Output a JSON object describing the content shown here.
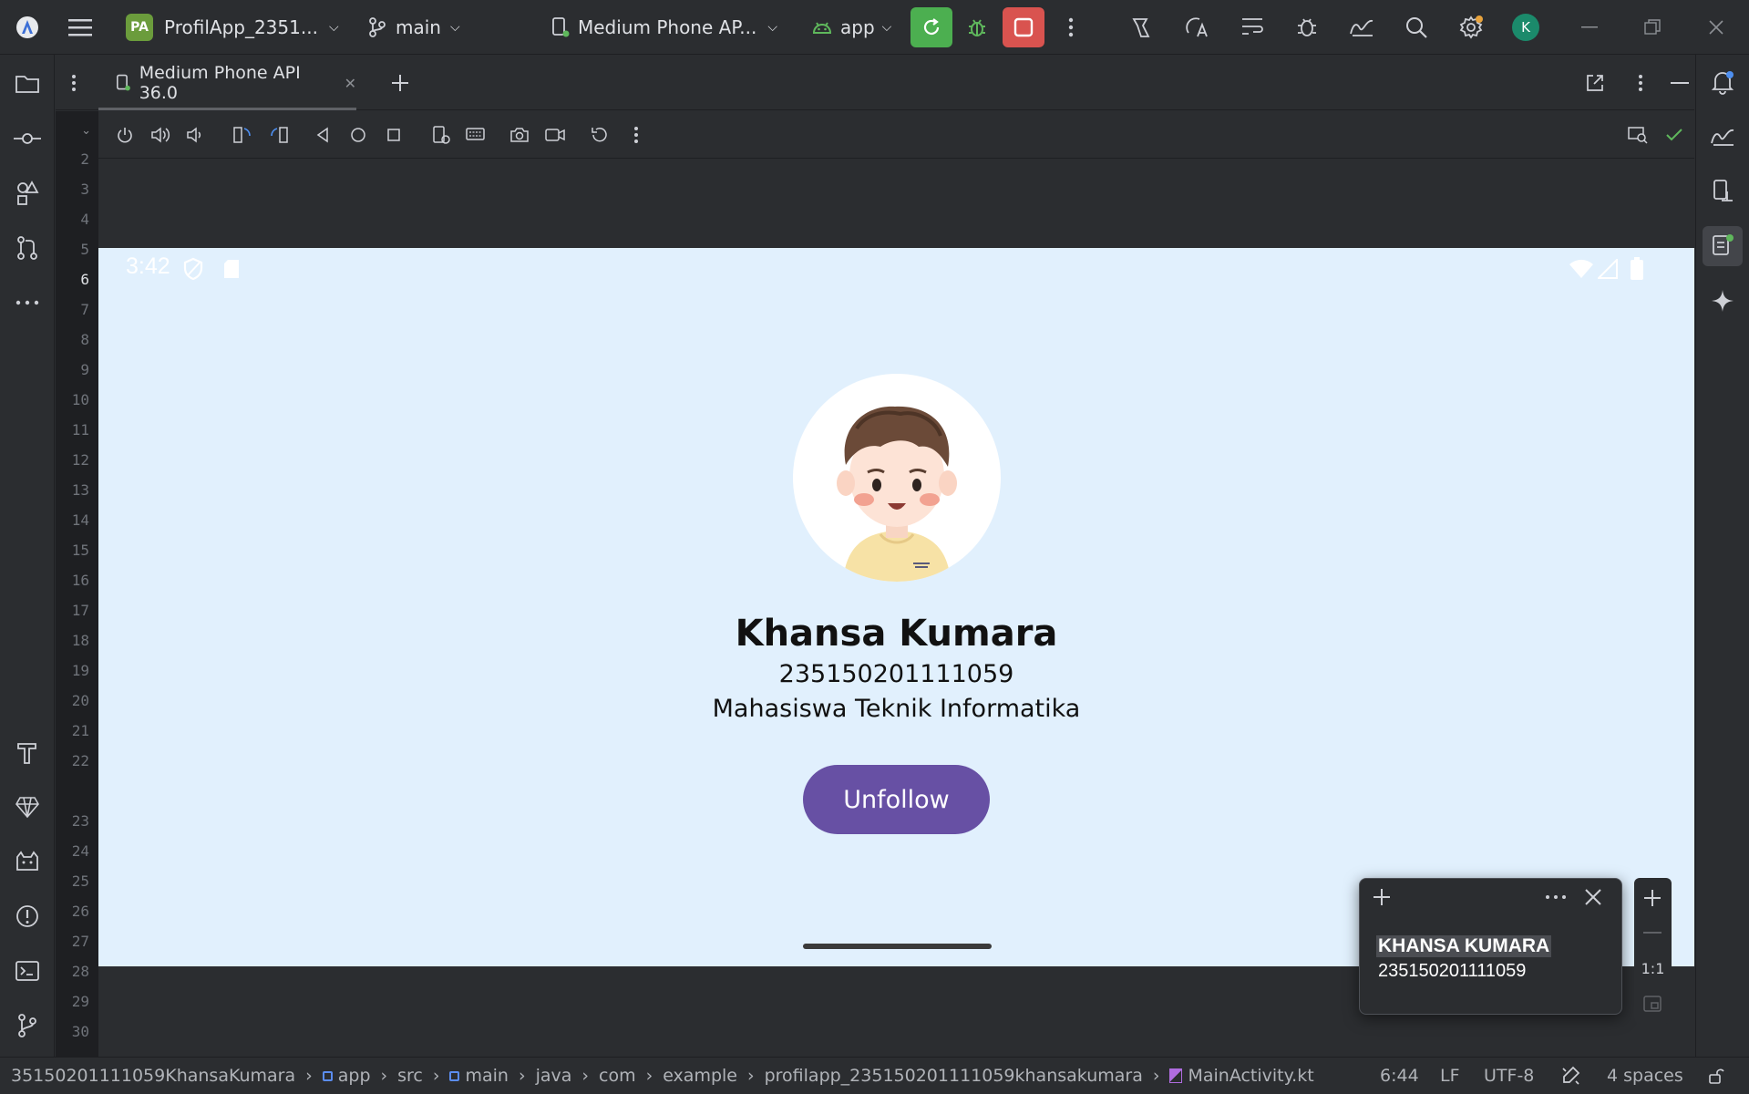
{
  "titlebar": {
    "project_badge": "PA",
    "project_name": "ProfilApp_2351...",
    "branch": "main",
    "device": "Medium Phone AP...",
    "run_config": "app",
    "user_initial": "K"
  },
  "tab": {
    "label": "Medium Phone API 36.0"
  },
  "line_numbers": [
    "2",
    "3",
    "4",
    "5",
    "6",
    "7",
    "8",
    "9",
    "10",
    "11",
    "12",
    "13",
    "14",
    "15",
    "16",
    "17",
    "18",
    "19",
    "20",
    "21",
    "22",
    "23",
    "24",
    "25",
    "26",
    "27",
    "28",
    "29",
    "30"
  ],
  "phone": {
    "clock": "3:42",
    "name": "Khansa Kumara",
    "nim": "235150201111059",
    "role": "Mahasiswa Teknik Informatika",
    "button_label": "Unfollow"
  },
  "popup": {
    "title": "KHANSA KUMARA",
    "subtitle": "235150201111059"
  },
  "zoom": {
    "ratio": "1:1"
  },
  "statusbar": {
    "breadcrumbs": [
      "35150201111059KhansaKumara",
      "app",
      "src",
      "main",
      "java",
      "com",
      "example",
      "profilapp_235150201111059khansakumara",
      "MainActivity.kt"
    ],
    "position": "6:44",
    "line_ending": "LF",
    "encoding": "UTF-8",
    "indent": "4 spaces"
  },
  "colors": {
    "ide_bg": "#2b2d30",
    "phone_bg": "#e1f0fd",
    "button": "#6750a4",
    "run_green": "#4caf50",
    "stop_red": "#d9534f"
  }
}
